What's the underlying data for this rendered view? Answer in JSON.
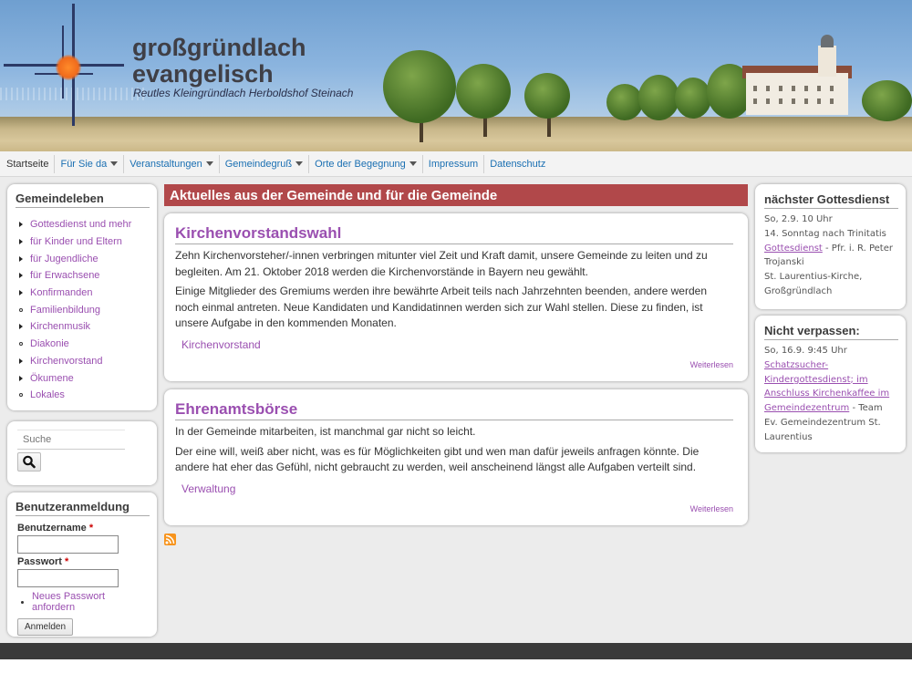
{
  "header": {
    "site_title_line1": "großgründlach",
    "site_title_line2": "evangelisch",
    "slogan": "Reutles Kleingründlach Herboldshof Steinach"
  },
  "nav": {
    "items": [
      {
        "label": "Startseite",
        "dropdown": false
      },
      {
        "label": "Für Sie da",
        "dropdown": true
      },
      {
        "label": "Veranstaltungen",
        "dropdown": true
      },
      {
        "label": "Gemeindegruß",
        "dropdown": true
      },
      {
        "label": "Orte der Begegnung",
        "dropdown": true
      },
      {
        "label": "Impressum",
        "dropdown": false
      },
      {
        "label": "Datenschutz",
        "dropdown": false
      }
    ]
  },
  "sidebar_left": {
    "menu_title": "Gemeindeleben",
    "menu_items": [
      {
        "label": "Gottesdienst und mehr",
        "bullet": "arrow"
      },
      {
        "label": "für Kinder und Eltern",
        "bullet": "arrow"
      },
      {
        "label": "für Jugendliche",
        "bullet": "arrow"
      },
      {
        "label": "für Erwachsene",
        "bullet": "arrow"
      },
      {
        "label": "Konfirmanden",
        "bullet": "arrow"
      },
      {
        "label": "Familienbildung",
        "bullet": "dot"
      },
      {
        "label": "Kirchenmusik",
        "bullet": "arrow"
      },
      {
        "label": "Diakonie",
        "bullet": "dot"
      },
      {
        "label": "Kirchenvorstand",
        "bullet": "arrow"
      },
      {
        "label": "Ökumene",
        "bullet": "arrow"
      },
      {
        "label": "Lokales",
        "bullet": "dot"
      }
    ],
    "search": {
      "placeholder": "Suche",
      "button_icon": "search-icon"
    },
    "login": {
      "title": "Benutzeranmeldung",
      "username_label": "Benutzername",
      "password_label": "Passwort",
      "required_mark": "*",
      "new_password_link": "Neues Passwort anfordern",
      "submit_label": "Anmelden"
    }
  },
  "main": {
    "section_title": "Aktuelles aus der Gemeinde und für die Gemeinde",
    "articles": [
      {
        "title": "Kirchenvorstandswahl",
        "paragraphs": [
          "Zehn  Kirchenvorsteher/-innen verbringen mitunter viel Zeit und Kraft damit, unsere Gemeinde zu leiten und zu begleiten. Am 21. Oktober 2018 werden die Kirchenvorstände in Bayern neu gewählt.",
          "Einige Mitglieder des Gremiums werden ihre bewährte Arbeit teils nach Jahrzehnten beenden, andere werden noch einmal antreten. Neue Kandidaten und Kandidatinnen werden sich zur Wahl stellen. Diese zu finden, ist unsere Aufgabe in den kommenden Monaten."
        ],
        "tag": "Kirchenvorstand",
        "read_more": "Weiterlesen"
      },
      {
        "title": "Ehrenamtsbörse",
        "paragraphs": [
          "In der Gemeinde mitarbeiten, ist manchmal gar nicht so leicht.",
          "Der eine will, weiß aber nicht, was es für Möglichkeiten gibt und wen man dafür jeweils anfragen könnte. Die andere hat eher das Gefühl, nicht gebraucht zu werden, weil anscheinend längst alle Aufgaben verteilt sind."
        ],
        "tag": "Verwaltung",
        "read_more": "Weiterlesen"
      }
    ],
    "feed_icon": "rss-icon"
  },
  "sidebar_right": {
    "next_service": {
      "title": "nächster Gottesdienst",
      "date": "So, 2.9. 10 Uhr",
      "occasion": "14. Sonntag nach Trinitatis",
      "link": "Gottesdienst",
      "person": " - Pfr. i. R. Peter Trojanski",
      "location": "St. Laurentius-Kirche, Großgründlach"
    },
    "dont_miss": {
      "title": "Nicht verpassen:",
      "date": "So, 16.9. 9:45 Uhr",
      "link": "Schatzsucher-Kindergottesdienst; im Anschluss Kirchenkaffee im Gemeindezentrum",
      "rest": " - Team Ev. Gemeindezentrum St. Laurentius"
    }
  },
  "colors": {
    "accent_red": "#b1484a",
    "link_purple": "#9a4fb0",
    "nav_blue": "#1a6fb2",
    "logo_orange": "#f06b1c"
  }
}
